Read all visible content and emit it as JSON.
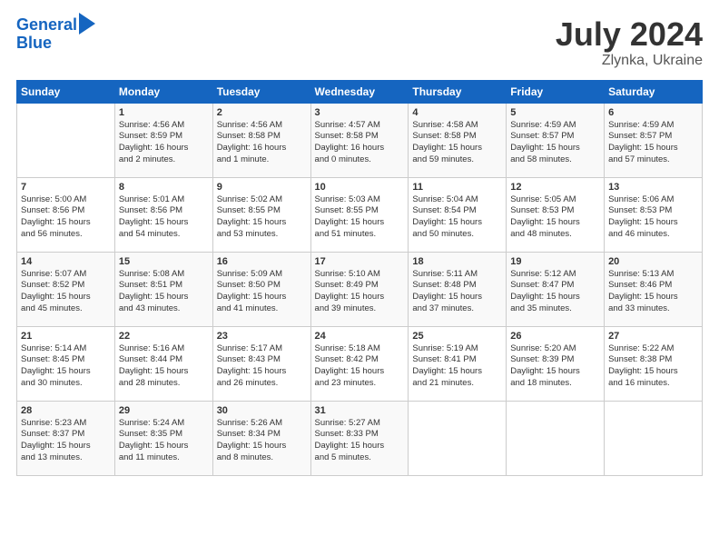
{
  "header": {
    "logo_line1": "General",
    "logo_line2": "Blue",
    "month": "July 2024",
    "location": "Zlynka, Ukraine"
  },
  "weekdays": [
    "Sunday",
    "Monday",
    "Tuesday",
    "Wednesday",
    "Thursday",
    "Friday",
    "Saturday"
  ],
  "weeks": [
    [
      {
        "num": "",
        "info": ""
      },
      {
        "num": "1",
        "info": "Sunrise: 4:56 AM\nSunset: 8:59 PM\nDaylight: 16 hours\nand 2 minutes."
      },
      {
        "num": "2",
        "info": "Sunrise: 4:56 AM\nSunset: 8:58 PM\nDaylight: 16 hours\nand 1 minute."
      },
      {
        "num": "3",
        "info": "Sunrise: 4:57 AM\nSunset: 8:58 PM\nDaylight: 16 hours\nand 0 minutes."
      },
      {
        "num": "4",
        "info": "Sunrise: 4:58 AM\nSunset: 8:58 PM\nDaylight: 15 hours\nand 59 minutes."
      },
      {
        "num": "5",
        "info": "Sunrise: 4:59 AM\nSunset: 8:57 PM\nDaylight: 15 hours\nand 58 minutes."
      },
      {
        "num": "6",
        "info": "Sunrise: 4:59 AM\nSunset: 8:57 PM\nDaylight: 15 hours\nand 57 minutes."
      }
    ],
    [
      {
        "num": "7",
        "info": "Sunrise: 5:00 AM\nSunset: 8:56 PM\nDaylight: 15 hours\nand 56 minutes."
      },
      {
        "num": "8",
        "info": "Sunrise: 5:01 AM\nSunset: 8:56 PM\nDaylight: 15 hours\nand 54 minutes."
      },
      {
        "num": "9",
        "info": "Sunrise: 5:02 AM\nSunset: 8:55 PM\nDaylight: 15 hours\nand 53 minutes."
      },
      {
        "num": "10",
        "info": "Sunrise: 5:03 AM\nSunset: 8:55 PM\nDaylight: 15 hours\nand 51 minutes."
      },
      {
        "num": "11",
        "info": "Sunrise: 5:04 AM\nSunset: 8:54 PM\nDaylight: 15 hours\nand 50 minutes."
      },
      {
        "num": "12",
        "info": "Sunrise: 5:05 AM\nSunset: 8:53 PM\nDaylight: 15 hours\nand 48 minutes."
      },
      {
        "num": "13",
        "info": "Sunrise: 5:06 AM\nSunset: 8:53 PM\nDaylight: 15 hours\nand 46 minutes."
      }
    ],
    [
      {
        "num": "14",
        "info": "Sunrise: 5:07 AM\nSunset: 8:52 PM\nDaylight: 15 hours\nand 45 minutes."
      },
      {
        "num": "15",
        "info": "Sunrise: 5:08 AM\nSunset: 8:51 PM\nDaylight: 15 hours\nand 43 minutes."
      },
      {
        "num": "16",
        "info": "Sunrise: 5:09 AM\nSunset: 8:50 PM\nDaylight: 15 hours\nand 41 minutes."
      },
      {
        "num": "17",
        "info": "Sunrise: 5:10 AM\nSunset: 8:49 PM\nDaylight: 15 hours\nand 39 minutes."
      },
      {
        "num": "18",
        "info": "Sunrise: 5:11 AM\nSunset: 8:48 PM\nDaylight: 15 hours\nand 37 minutes."
      },
      {
        "num": "19",
        "info": "Sunrise: 5:12 AM\nSunset: 8:47 PM\nDaylight: 15 hours\nand 35 minutes."
      },
      {
        "num": "20",
        "info": "Sunrise: 5:13 AM\nSunset: 8:46 PM\nDaylight: 15 hours\nand 33 minutes."
      }
    ],
    [
      {
        "num": "21",
        "info": "Sunrise: 5:14 AM\nSunset: 8:45 PM\nDaylight: 15 hours\nand 30 minutes."
      },
      {
        "num": "22",
        "info": "Sunrise: 5:16 AM\nSunset: 8:44 PM\nDaylight: 15 hours\nand 28 minutes."
      },
      {
        "num": "23",
        "info": "Sunrise: 5:17 AM\nSunset: 8:43 PM\nDaylight: 15 hours\nand 26 minutes."
      },
      {
        "num": "24",
        "info": "Sunrise: 5:18 AM\nSunset: 8:42 PM\nDaylight: 15 hours\nand 23 minutes."
      },
      {
        "num": "25",
        "info": "Sunrise: 5:19 AM\nSunset: 8:41 PM\nDaylight: 15 hours\nand 21 minutes."
      },
      {
        "num": "26",
        "info": "Sunrise: 5:20 AM\nSunset: 8:39 PM\nDaylight: 15 hours\nand 18 minutes."
      },
      {
        "num": "27",
        "info": "Sunrise: 5:22 AM\nSunset: 8:38 PM\nDaylight: 15 hours\nand 16 minutes."
      }
    ],
    [
      {
        "num": "28",
        "info": "Sunrise: 5:23 AM\nSunset: 8:37 PM\nDaylight: 15 hours\nand 13 minutes."
      },
      {
        "num": "29",
        "info": "Sunrise: 5:24 AM\nSunset: 8:35 PM\nDaylight: 15 hours\nand 11 minutes."
      },
      {
        "num": "30",
        "info": "Sunrise: 5:26 AM\nSunset: 8:34 PM\nDaylight: 15 hours\nand 8 minutes."
      },
      {
        "num": "31",
        "info": "Sunrise: 5:27 AM\nSunset: 8:33 PM\nDaylight: 15 hours\nand 5 minutes."
      },
      {
        "num": "",
        "info": ""
      },
      {
        "num": "",
        "info": ""
      },
      {
        "num": "",
        "info": ""
      }
    ]
  ]
}
